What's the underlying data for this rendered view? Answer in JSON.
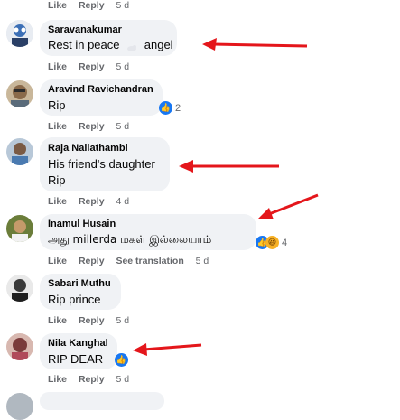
{
  "colors": {
    "bubble": "#f0f2f5",
    "action_text": "#65676b",
    "arrow": "#e4161b",
    "like_blue": "#1877f2"
  },
  "top_actions": {
    "like": "Like",
    "reply": "Reply",
    "time": "5 d"
  },
  "comments": [
    {
      "author": "Saravanakumar",
      "text": "Rest in peace",
      "text_tail": "angel",
      "actions": {
        "like": "Like",
        "reply": "Reply",
        "time": "5 d"
      }
    },
    {
      "author": "Aravind Ravichandran",
      "text": "Rip",
      "reaction_count": "2",
      "actions": {
        "like": "Like",
        "reply": "Reply",
        "time": "5 d"
      }
    },
    {
      "author": "Raja Nallathambi",
      "text_lines": [
        "His friend's daughter",
        "Rip"
      ],
      "actions": {
        "like": "Like",
        "reply": "Reply",
        "time": "4 d"
      }
    },
    {
      "author": "Inamul Husain",
      "text": "அது millerda மகள் இல்லையாம்",
      "reaction_count": "4",
      "actions": {
        "like": "Like",
        "reply": "Reply",
        "translate": "See translation",
        "time": "5 d"
      }
    },
    {
      "author": "Sabari Muthu",
      "text": "Rip prince",
      "actions": {
        "like": "Like",
        "reply": "Reply",
        "time": "5 d"
      }
    },
    {
      "author": "Nila Kanghal",
      "text": "RIP DEAR",
      "actions": {
        "like": "Like",
        "reply": "Reply",
        "time": "5 d"
      }
    }
  ]
}
